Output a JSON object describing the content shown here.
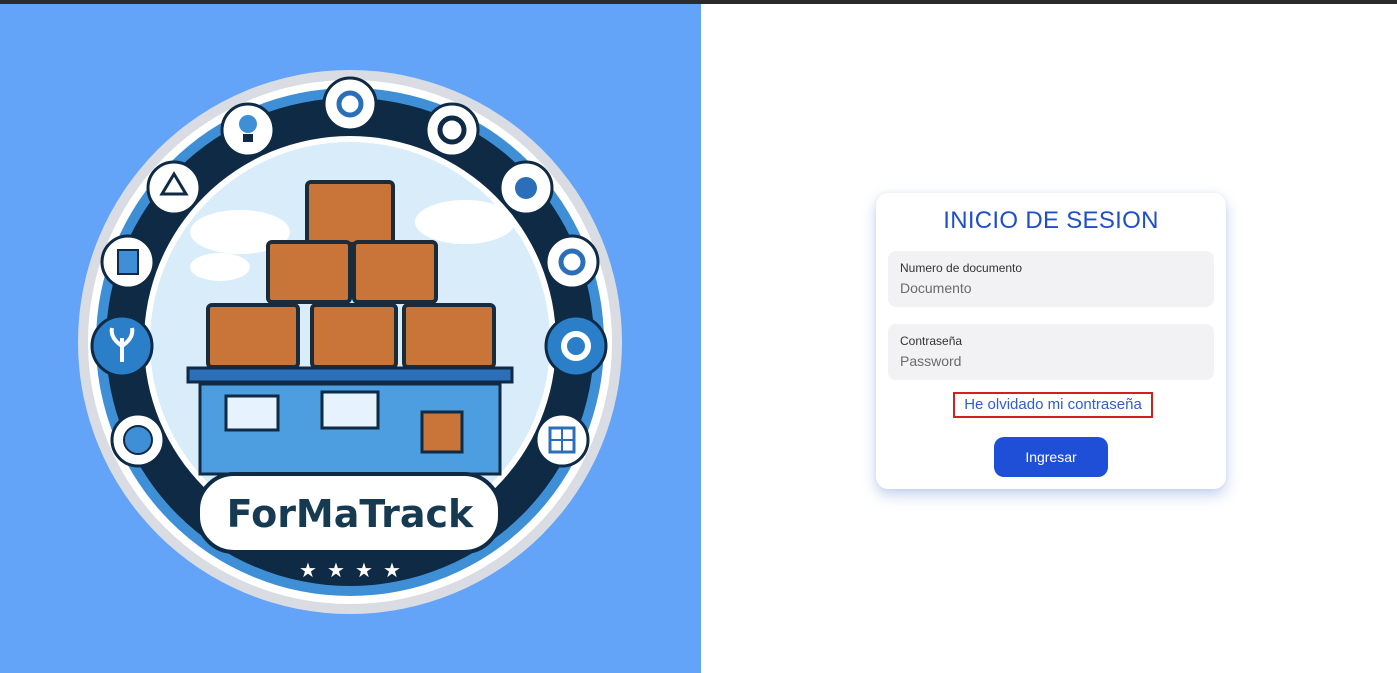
{
  "brand": {
    "logo_text": "ForMaTrack",
    "stars": 4
  },
  "login": {
    "title": "INICIO DE SESION",
    "document_label": "Numero de documento",
    "document_placeholder": "Documento",
    "document_value": "",
    "password_label": "Contraseña",
    "password_placeholder": "Password",
    "password_value": "",
    "forgot_link": "He olvidado mi contraseña",
    "submit_label": "Ingresar"
  },
  "colors": {
    "left_background": "#63a4f8",
    "accent": "#1e4fd6",
    "title": "#1f4fc7",
    "highlight_border": "#d21f1f"
  }
}
